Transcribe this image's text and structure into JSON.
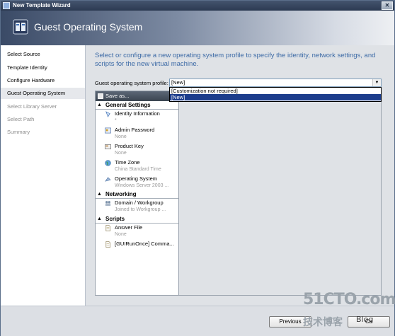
{
  "window": {
    "title": "New Template Wizard",
    "header_title": "Guest Operating System",
    "close_glyph": "✕"
  },
  "sidebar": {
    "items": [
      {
        "label": "Select Source",
        "state": "enabled"
      },
      {
        "label": "Template Identity",
        "state": "enabled"
      },
      {
        "label": "Configure Hardware",
        "state": "enabled"
      },
      {
        "label": "Guest Operating System",
        "state": "active"
      },
      {
        "label": "Select Library Server",
        "state": "disabled"
      },
      {
        "label": "Select Path",
        "state": "disabled"
      },
      {
        "label": "Summary",
        "state": "disabled"
      }
    ]
  },
  "main": {
    "intro": "Select or configure a new operating system profile to specify the identity, network settings, and scripts for the new virtual machine.",
    "profile_label": "Guest operating system profile:",
    "profile_value": "[New]",
    "profile_options": [
      "[Customization not required]",
      "[New]"
    ],
    "save_as_label": "Save as...",
    "groups": [
      {
        "title": "General Settings",
        "items": [
          {
            "name": "Identity Information",
            "value": "*",
            "icon": "identity-icon"
          },
          {
            "name": "Admin Password",
            "value": "None",
            "icon": "password-icon"
          },
          {
            "name": "Product Key",
            "value": "None",
            "icon": "product-key-icon"
          },
          {
            "name": "Time Zone",
            "value": "China Standard Time",
            "icon": "globe-icon"
          },
          {
            "name": "Operating System",
            "value": "Windows Server 2003 ...",
            "icon": "os-icon"
          }
        ]
      },
      {
        "title": "Networking",
        "items": [
          {
            "name": "Domain / Workgroup",
            "value": "Joined to Workgroup ...",
            "icon": "users-icon"
          }
        ]
      },
      {
        "title": "Scripts",
        "items": [
          {
            "name": "Answer File",
            "value": "None",
            "icon": "file-icon"
          },
          {
            "name": "[GUIRunOnce] Comma...",
            "value": "",
            "icon": "command-icon"
          }
        ]
      }
    ]
  },
  "footer": {
    "previous_label": "Previous",
    "cancel_label": "Ca"
  },
  "watermark": {
    "main": "51CTO.com",
    "cn": "技术博客",
    "blog": "Blog"
  }
}
